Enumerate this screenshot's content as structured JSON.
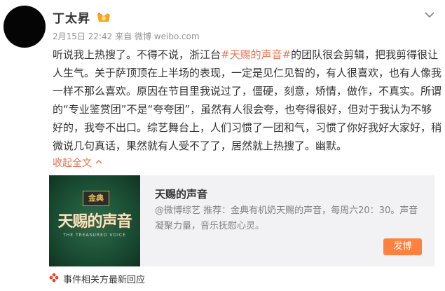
{
  "author": {
    "name": "丁太昇"
  },
  "meta": {
    "time": "2月15日 22:42",
    "source_prefix": "来自",
    "source": "微博 weibo.com"
  },
  "post": {
    "text_before": "听说我上热搜了。不得不说，浙江台",
    "hashtag": "#天赐的声音#",
    "text_after": "的团队很会剪辑，把我剪得很让人生气。关于萨顶顶在上半场的表现，一定是见仁见智的，有人很喜欢，也有人像我一样不那么喜欢。原因在节目里我说过了，僵硬，刻意，矫情，做作，不真实。所谓的“专业鉴赏团”不是“夸夸团”，虽然有人很会夸，也夸得很好，但对于我认为不够好的，我夸不出口。综艺舞台上，人们习惯了一团和气，习惯了你好我好大家好，稍微说几句真话，果然就有人受不了了，居然就上热搜了。幽默。",
    "collapse_label": "收起全文"
  },
  "card": {
    "cover_badge": "金典",
    "cover_title": "天赐的声音",
    "cover_subtitle": "THE TREASURED VOICE",
    "title": "天赐的声音",
    "description": "@微博综艺 推荐：金典有机奶天赐的声音，每周六20：30。声音凝聚力量，音乐抚慰心灵。",
    "button_label": "发博"
  },
  "footer": {
    "label": "事件相关方最新回应"
  },
  "colors": {
    "accent": "#eb7350",
    "button": "#ff8140",
    "card_bg": "#f2f2f5"
  }
}
